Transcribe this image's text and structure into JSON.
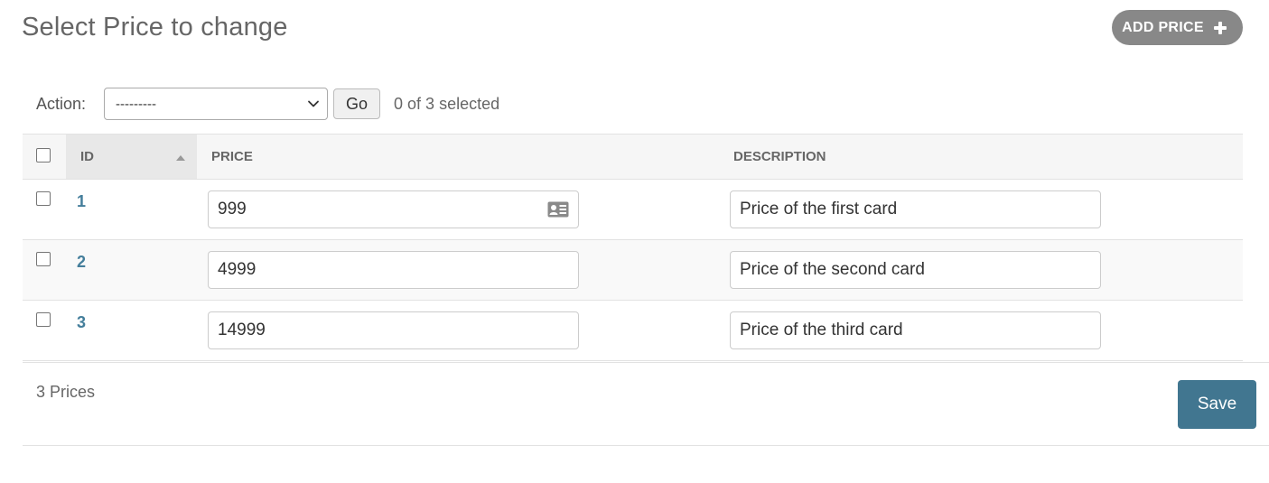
{
  "header": {
    "title": "Select Price to change",
    "add_button_label": "ADD PRICE"
  },
  "actions": {
    "label": "Action:",
    "selected_option": "---------",
    "go_label": "Go",
    "selection_counter": "0 of 3 selected"
  },
  "table": {
    "columns": {
      "id": "ID",
      "price": "PRICE",
      "description": "DESCRIPTION"
    },
    "sort": {
      "column": "ID",
      "direction": "ascending"
    },
    "rows": [
      {
        "id": "1",
        "price": "999",
        "description": "Price of the first card"
      },
      {
        "id": "2",
        "price": "4999",
        "description": "Price of the second card"
      },
      {
        "id": "3",
        "price": "14999",
        "description": "Price of the third card"
      }
    ]
  },
  "footer": {
    "result_count": "3 Prices",
    "save_label": "Save"
  },
  "icons": {
    "add": "plus-icon",
    "select": "chevron-down-icon",
    "sort": "sort-up-icon",
    "autofill": "contact-card-icon"
  },
  "colors": {
    "link": "#447e9b",
    "save_button": "#417690",
    "add_button": "#888888"
  }
}
